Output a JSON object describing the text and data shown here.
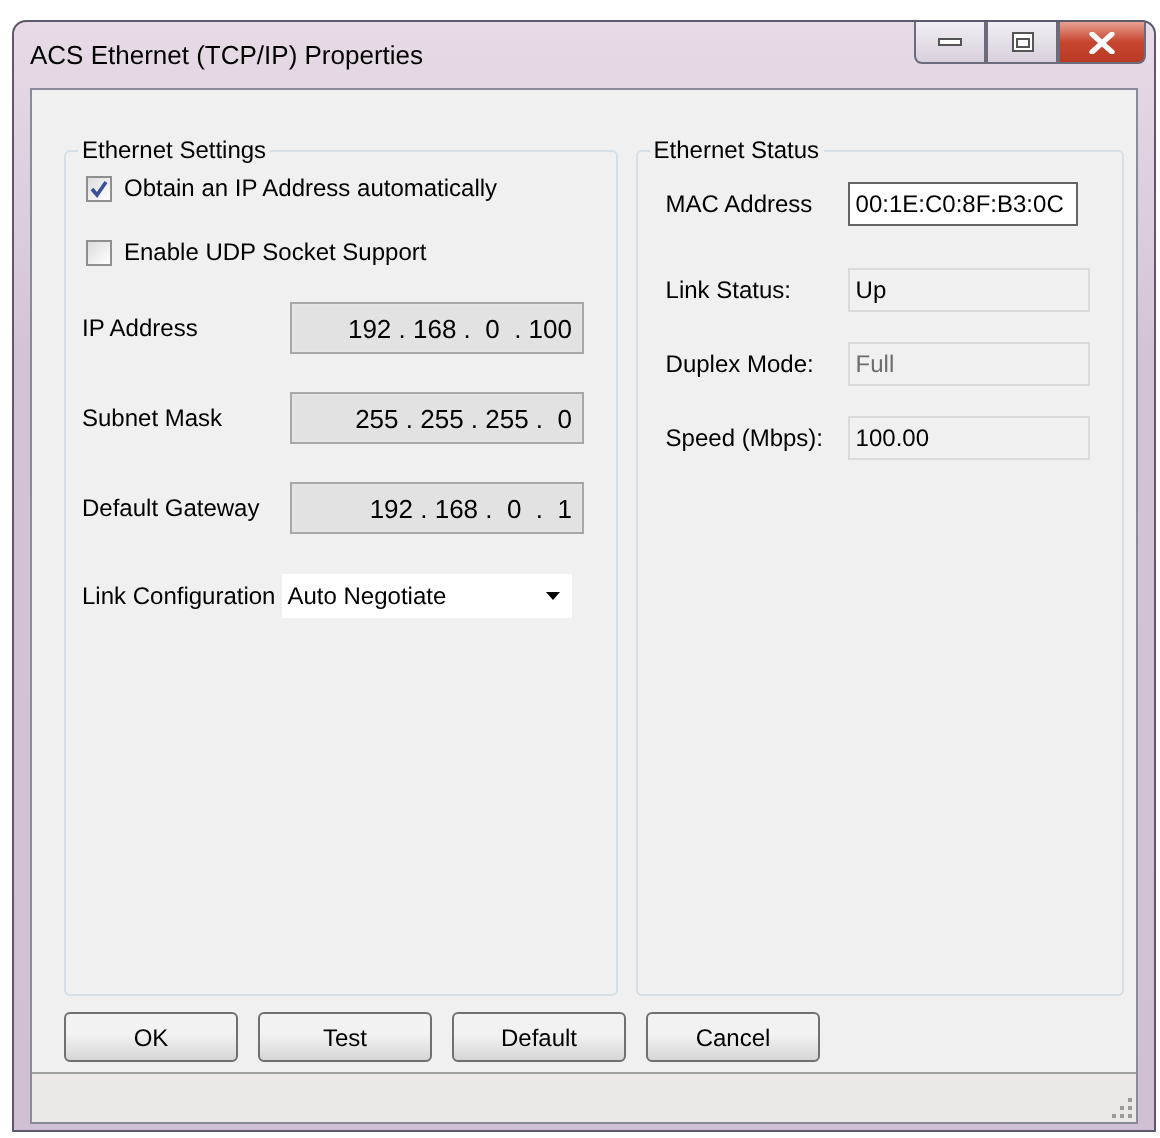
{
  "window": {
    "title": "ACS Ethernet (TCP/IP) Properties"
  },
  "ethernet_settings": {
    "title": "Ethernet Settings",
    "checkboxes": [
      {
        "label": "Obtain an IP Address automatically",
        "checked": true
      },
      {
        "label": "Enable UDP Socket Support",
        "checked": false
      }
    ],
    "address_fields": [
      {
        "label": "IP Address",
        "value": "192 . 168 .  0  . 100",
        "disabled": true
      },
      {
        "label": "Subnet Mask",
        "value": "255 . 255 . 255 .  0",
        "disabled": true
      },
      {
        "label": "Default Gateway",
        "value": "192 . 168 .  0  .  1",
        "disabled": true
      }
    ],
    "link_configuration": {
      "label": "Link Configuration",
      "value": "Auto Negotiate"
    }
  },
  "ethernet_status": {
    "title": "Ethernet Status",
    "fields": [
      {
        "label": "MAC Address",
        "value": "00:1E:C0:8F:B3:0C",
        "kind": "boxed",
        "disabled": false
      },
      {
        "label": "Link Status:",
        "value": "Up",
        "kind": "readonly",
        "disabled": false
      },
      {
        "label": "Duplex Mode:",
        "value": "Full",
        "kind": "readonly",
        "disabled": true
      },
      {
        "label": "Speed (Mbps):",
        "value": "100.00",
        "kind": "readonly",
        "disabled": false
      }
    ]
  },
  "buttons": [
    "OK",
    "Test",
    "Default",
    "Cancel"
  ]
}
